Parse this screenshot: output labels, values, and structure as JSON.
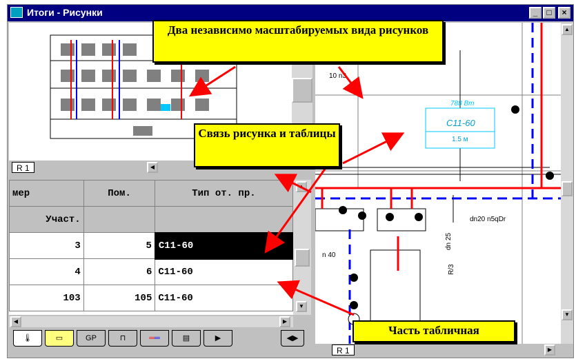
{
  "window": {
    "title": "Итоги - Рисунки",
    "min_label": "_",
    "max_label": "□",
    "close_label": "×"
  },
  "drawing": {
    "top_tab": "R 1",
    "right_tab": "R 1",
    "radiator_power": "788 Вт",
    "radiator_type": "C11-60",
    "radiator_length": "1.5 м",
    "pipe_label_top": "10 n3",
    "pipe_label_right": "dn20 n5qDr",
    "pipe_label_left": "n 40",
    "pipe_vertical": "dn 25",
    "pipe_code": "R/3"
  },
  "table": {
    "columns": [
      "мер",
      "Пом.",
      "Тип от. пр."
    ],
    "subheader": [
      "Участ.",
      "",
      ""
    ],
    "rows": [
      {
        "a": "3",
        "b": "5",
        "c": "C11-60",
        "selected": true
      },
      {
        "a": "4",
        "b": "6",
        "c": "C11-60",
        "selected": false
      },
      {
        "a": "103",
        "b": "105",
        "c": "C11-60",
        "selected": false
      }
    ]
  },
  "bottom_tabs": [
    "thermostat-icon",
    "folder-icon",
    "gp-icon",
    "schema-icon",
    "pipes-icon",
    "calc-icon",
    "play-icon"
  ],
  "callouts": {
    "views": "Два независимо масштабируемых вида рисунков",
    "link": "Связь рисунка и таблицы",
    "table_part": "Часть табличная"
  },
  "colors": {
    "title_bar": "#000080",
    "callout_bg": "#ffff00",
    "arrow": "#ff0000",
    "pipe_supply": "#ff0000",
    "pipe_return": "#0000ff",
    "radiator": "#00c8ff"
  }
}
